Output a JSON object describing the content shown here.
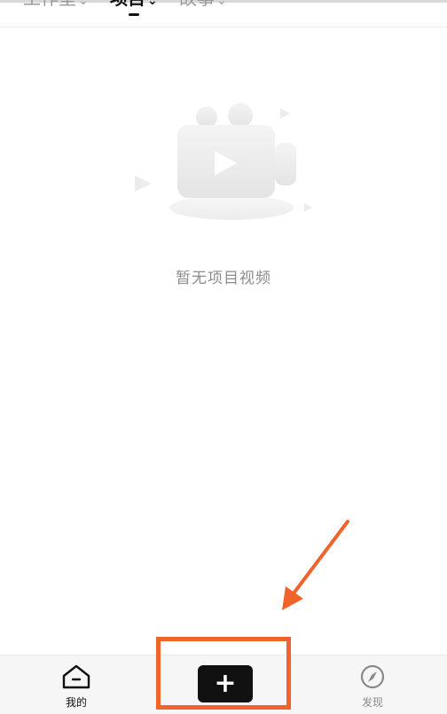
{
  "top_tabs": [
    {
      "label": "工作室",
      "active": false
    },
    {
      "label": "项目",
      "active": true
    },
    {
      "label": "故事",
      "active": false
    }
  ],
  "empty_state": {
    "icon": "video-camera-play-icon",
    "message": "暂无项目视频"
  },
  "bottom_nav": {
    "mine_label": "我的",
    "mine_icon": "home-icon",
    "add_icon": "plus-icon",
    "add_symbol": "+",
    "discover_label": "发现",
    "discover_icon": "compass-icon"
  },
  "annotation": {
    "color": "#f0632b",
    "arrow_icon": "arrow-icon"
  }
}
